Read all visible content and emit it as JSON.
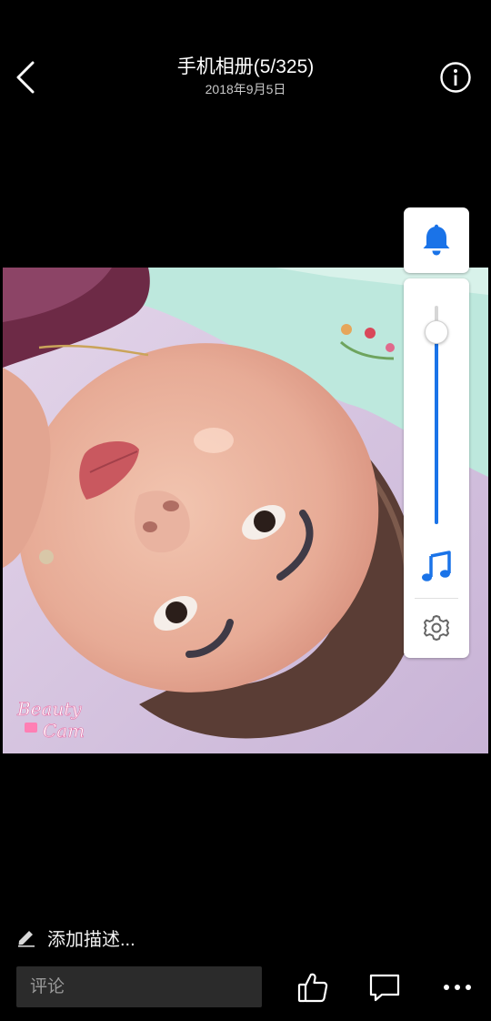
{
  "header": {
    "title": "手机相册(5/325)",
    "date": "2018年9月5日",
    "back_icon": "chevron-left-icon",
    "info_icon": "info-circle-icon"
  },
  "photo": {
    "watermark_line1": "Beauty",
    "watermark_line2": "Cam"
  },
  "volume_panel": {
    "ringer_icon": "bell-icon",
    "media_icon": "music-note-icon",
    "settings_icon": "gear-icon",
    "level": 0.88,
    "accent_color": "#1a73e8"
  },
  "bottom": {
    "description_label": "添加描述...",
    "edit_icon": "pencil-icon",
    "comment_placeholder": "评论",
    "like_icon": "thumbs-up-icon",
    "comment_icon": "comment-bubble-icon",
    "more_icon": "more-dots-icon"
  }
}
